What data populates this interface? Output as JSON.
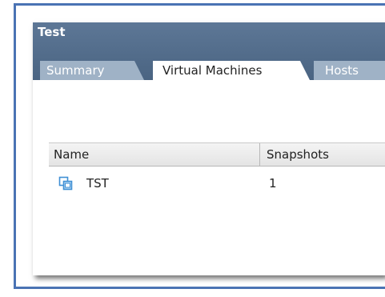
{
  "header": {
    "title": "Test"
  },
  "tabs": [
    {
      "label": "Summary",
      "active": false
    },
    {
      "label": "Virtual Machines",
      "active": true
    },
    {
      "label": "Hosts",
      "active": false
    }
  ],
  "table": {
    "columns": [
      "Name",
      "Snapshots"
    ],
    "rows": [
      {
        "icon": "vm-icon",
        "name": "TST",
        "snapshots": "1"
      }
    ]
  },
  "colors": {
    "frame_border": "#4a73b4",
    "header_bg": "#5d7796",
    "inactive_tab_bg": "#9fb2c6",
    "vm_icon": "#3f8fd4"
  }
}
